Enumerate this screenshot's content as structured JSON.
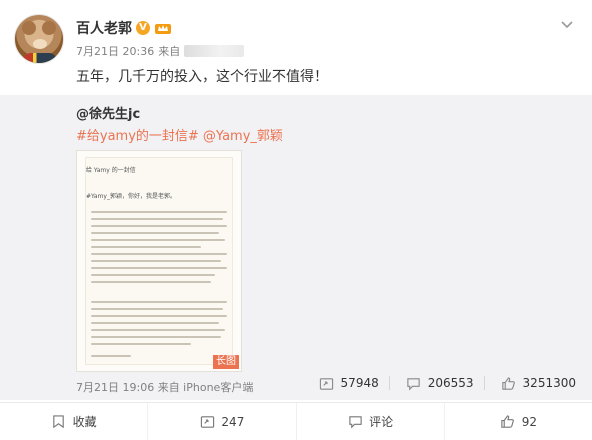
{
  "post": {
    "username": "百人老郭",
    "verified_badge": "V",
    "time": "7月21日 20:36",
    "source_prefix": "来自",
    "text": "五年，几千万的投入，这个行业不值得！"
  },
  "repost": {
    "author": "@徐先生jc",
    "text": "#给yamy的一封信# @Yamy_郭颖",
    "image": {
      "letter_title": "给 Yamy 的一封信",
      "letter_greeting": "#Yamy_郭颖，你好，我是老郭。",
      "long_image_badge": "长图"
    },
    "meta": "7月21日 19:06 来自 iPhone客户端",
    "stats": {
      "reposts": "57948",
      "comments": "206553",
      "likes": "3251300"
    }
  },
  "actions": {
    "favorite": "收藏",
    "repost": "247",
    "comment": "评论",
    "like": "92"
  },
  "colors": {
    "accent": "#eb7350",
    "repost_bg": "#f2f2f5",
    "verified": "#f6a623"
  },
  "icons": [
    "chevron-down-icon",
    "verified-icon",
    "crown-icon",
    "repost-icon",
    "comment-icon",
    "like-icon",
    "favorite-icon"
  ]
}
